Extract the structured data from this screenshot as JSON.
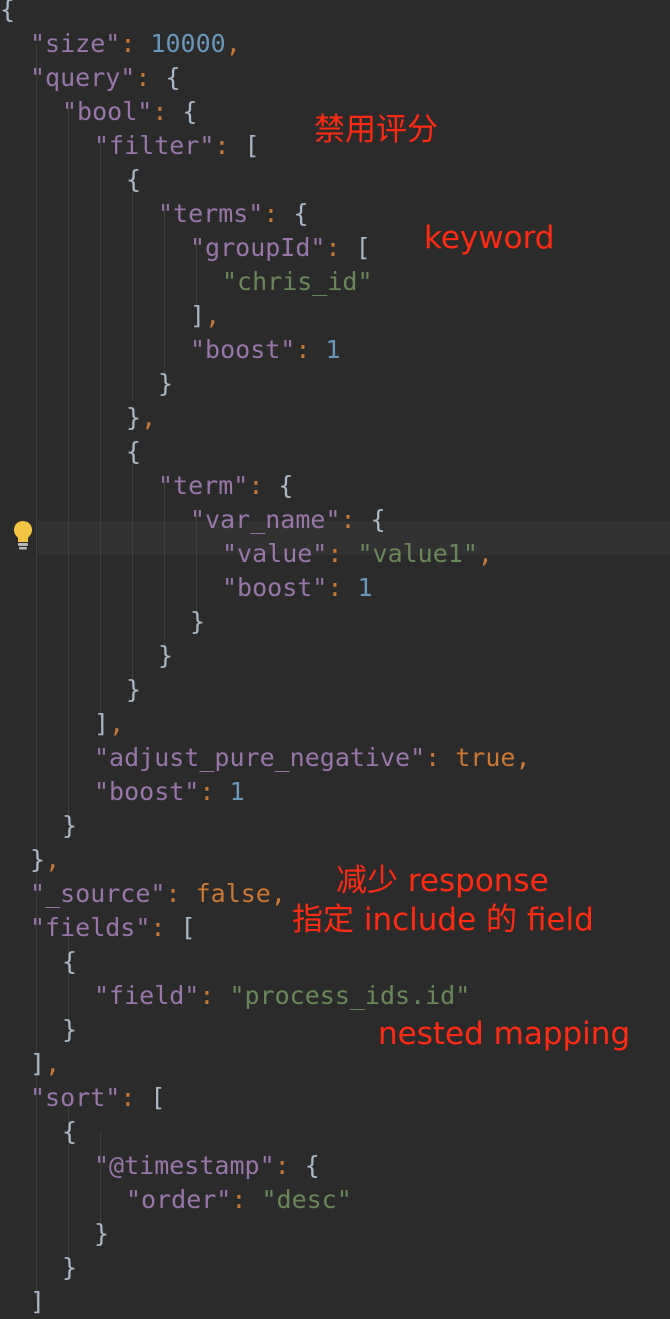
{
  "code": {
    "lines": [
      {
        "tokens": [
          {
            "t": "{",
            "c": "p"
          }
        ]
      },
      {
        "tokens": [
          {
            "t": "\"size\"",
            "c": "k"
          },
          {
            "t": ": ",
            "c": "c"
          },
          {
            "t": "10000",
            "c": "n"
          },
          {
            "t": ",",
            "c": "c"
          }
        ]
      },
      {
        "tokens": [
          {
            "t": "\"query\"",
            "c": "k"
          },
          {
            "t": ": ",
            "c": "c"
          },
          {
            "t": "{",
            "c": "p"
          }
        ]
      },
      {
        "tokens": [
          {
            "t": "\"bool\"",
            "c": "k"
          },
          {
            "t": ": ",
            "c": "c"
          },
          {
            "t": "{",
            "c": "p"
          }
        ]
      },
      {
        "tokens": [
          {
            "t": "\"filter\"",
            "c": "k"
          },
          {
            "t": ": ",
            "c": "c"
          },
          {
            "t": "[",
            "c": "p"
          }
        ]
      },
      {
        "tokens": [
          {
            "t": "{",
            "c": "p"
          }
        ]
      },
      {
        "tokens": [
          {
            "t": "\"terms\"",
            "c": "k"
          },
          {
            "t": ": ",
            "c": "c"
          },
          {
            "t": "{",
            "c": "p"
          }
        ]
      },
      {
        "tokens": [
          {
            "t": "\"groupId\"",
            "c": "k"
          },
          {
            "t": ": ",
            "c": "c"
          },
          {
            "t": "[",
            "c": "p"
          }
        ]
      },
      {
        "tokens": [
          {
            "t": "\"chris_id\"",
            "c": "s"
          }
        ]
      },
      {
        "tokens": [
          {
            "t": "]",
            "c": "p"
          },
          {
            "t": ",",
            "c": "c"
          }
        ]
      },
      {
        "tokens": [
          {
            "t": "\"boost\"",
            "c": "k"
          },
          {
            "t": ": ",
            "c": "c"
          },
          {
            "t": "1",
            "c": "n"
          }
        ]
      },
      {
        "tokens": [
          {
            "t": "}",
            "c": "p"
          }
        ]
      },
      {
        "tokens": [
          {
            "t": "}",
            "c": "p"
          },
          {
            "t": ",",
            "c": "c"
          }
        ]
      },
      {
        "tokens": [
          {
            "t": "{",
            "c": "p"
          }
        ]
      },
      {
        "tokens": [
          {
            "t": "\"term\"",
            "c": "k"
          },
          {
            "t": ": ",
            "c": "c"
          },
          {
            "t": "{",
            "c": "p"
          }
        ]
      },
      {
        "tokens": [
          {
            "t": "\"var_name\"",
            "c": "k"
          },
          {
            "t": ": ",
            "c": "c"
          },
          {
            "t": "{",
            "c": "p"
          }
        ]
      },
      {
        "tokens": [
          {
            "t": "\"value\"",
            "c": "k"
          },
          {
            "t": ": ",
            "c": "c"
          },
          {
            "t": "\"value1\"",
            "c": "s"
          },
          {
            "t": ",",
            "c": "c"
          }
        ]
      },
      {
        "tokens": [
          {
            "t": "\"boost\"",
            "c": "k"
          },
          {
            "t": ": ",
            "c": "c"
          },
          {
            "t": "1",
            "c": "n"
          }
        ]
      },
      {
        "tokens": [
          {
            "t": "}",
            "c": "p"
          }
        ]
      },
      {
        "tokens": [
          {
            "t": "}",
            "c": "p"
          }
        ]
      },
      {
        "tokens": [
          {
            "t": "}",
            "c": "p"
          }
        ]
      },
      {
        "tokens": [
          {
            "t": "]",
            "c": "p"
          },
          {
            "t": ",",
            "c": "c"
          }
        ]
      },
      {
        "tokens": [
          {
            "t": "\"adjust_pure_negative\"",
            "c": "k"
          },
          {
            "t": ": ",
            "c": "c"
          },
          {
            "t": "true",
            "c": "kw"
          },
          {
            "t": ",",
            "c": "c"
          }
        ]
      },
      {
        "tokens": [
          {
            "t": "\"boost\"",
            "c": "k"
          },
          {
            "t": ": ",
            "c": "c"
          },
          {
            "t": "1",
            "c": "n"
          }
        ]
      },
      {
        "tokens": [
          {
            "t": "}",
            "c": "p"
          }
        ]
      },
      {
        "tokens": [
          {
            "t": "}",
            "c": "p"
          },
          {
            "t": ",",
            "c": "c"
          }
        ]
      },
      {
        "tokens": [
          {
            "t": "\"_source\"",
            "c": "k"
          },
          {
            "t": ": ",
            "c": "c"
          },
          {
            "t": "false",
            "c": "kw"
          },
          {
            "t": ",",
            "c": "c"
          }
        ]
      },
      {
        "tokens": [
          {
            "t": "\"fields\"",
            "c": "k"
          },
          {
            "t": ": ",
            "c": "c"
          },
          {
            "t": "[",
            "c": "p"
          }
        ]
      },
      {
        "tokens": [
          {
            "t": "{",
            "c": "p"
          }
        ]
      },
      {
        "tokens": [
          {
            "t": "\"field\"",
            "c": "k"
          },
          {
            "t": ": ",
            "c": "c"
          },
          {
            "t": "\"process_ids.id\"",
            "c": "s"
          }
        ]
      },
      {
        "tokens": [
          {
            "t": "}",
            "c": "p"
          }
        ]
      },
      {
        "tokens": [
          {
            "t": "]",
            "c": "p"
          },
          {
            "t": ",",
            "c": "c"
          }
        ]
      },
      {
        "tokens": [
          {
            "t": "\"sort\"",
            "c": "k"
          },
          {
            "t": ": ",
            "c": "c"
          },
          {
            "t": "[",
            "c": "p"
          }
        ]
      },
      {
        "tokens": [
          {
            "t": "{",
            "c": "p"
          }
        ]
      },
      {
        "tokens": [
          {
            "t": "\"@timestamp\"",
            "c": "k"
          },
          {
            "t": ": ",
            "c": "c"
          },
          {
            "t": "{",
            "c": "p"
          }
        ]
      },
      {
        "tokens": [
          {
            "t": "\"order\"",
            "c": "k"
          },
          {
            "t": ": ",
            "c": "c"
          },
          {
            "t": "\"desc\"",
            "c": "s"
          }
        ]
      },
      {
        "tokens": [
          {
            "t": "}",
            "c": "p"
          }
        ]
      },
      {
        "tokens": [
          {
            "t": "}",
            "c": "p"
          }
        ]
      },
      {
        "tokens": [
          {
            "t": "]",
            "c": "p"
          }
        ]
      }
    ]
  },
  "annotations": {
    "filter_note": "禁用评分",
    "keyword_note": "keyword",
    "source_note": "减少 response",
    "fields_note": "指定 include 的 field",
    "nested_note": "nested mapping"
  },
  "gutter": {
    "bulb_icon": "lightbulb-icon",
    "bulb_color": "#f4c542"
  },
  "theme": {
    "background": "#2b2b2b",
    "property_color": "#9876aa",
    "string_color": "#6a8759",
    "number_color": "#6897bb",
    "keyword_color": "#cc7832",
    "annotation_color": "#ff2a12"
  }
}
